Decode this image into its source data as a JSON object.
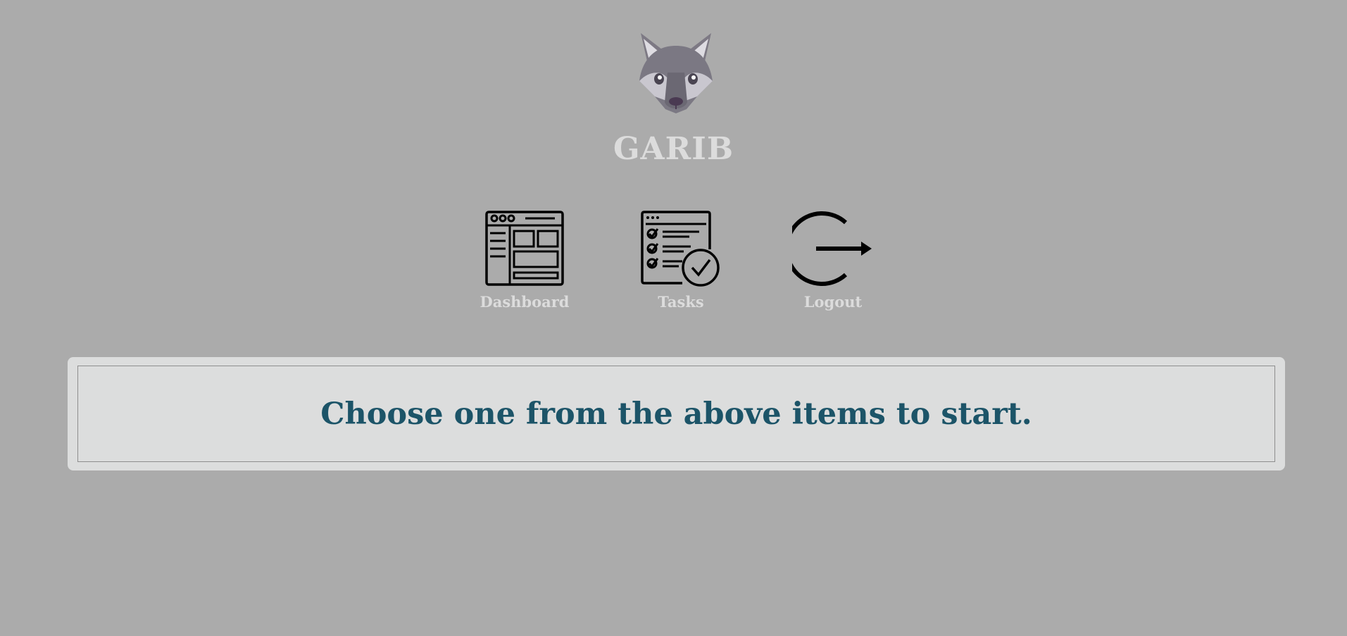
{
  "app": {
    "brand": "GARIB",
    "logo_icon": "wolf-head-logo"
  },
  "nav": {
    "items": [
      {
        "label": "Dashboard",
        "icon": "dashboard-icon"
      },
      {
        "label": "Tasks",
        "icon": "tasks-checklist-icon"
      },
      {
        "label": "Logout",
        "icon": "logout-icon"
      }
    ]
  },
  "main": {
    "message": "Choose one from the above items to start."
  },
  "colors": {
    "background": "#ababab",
    "panel": "#dcdddd",
    "message_text": "#1c5468",
    "light_text": "#dcdcdc"
  }
}
